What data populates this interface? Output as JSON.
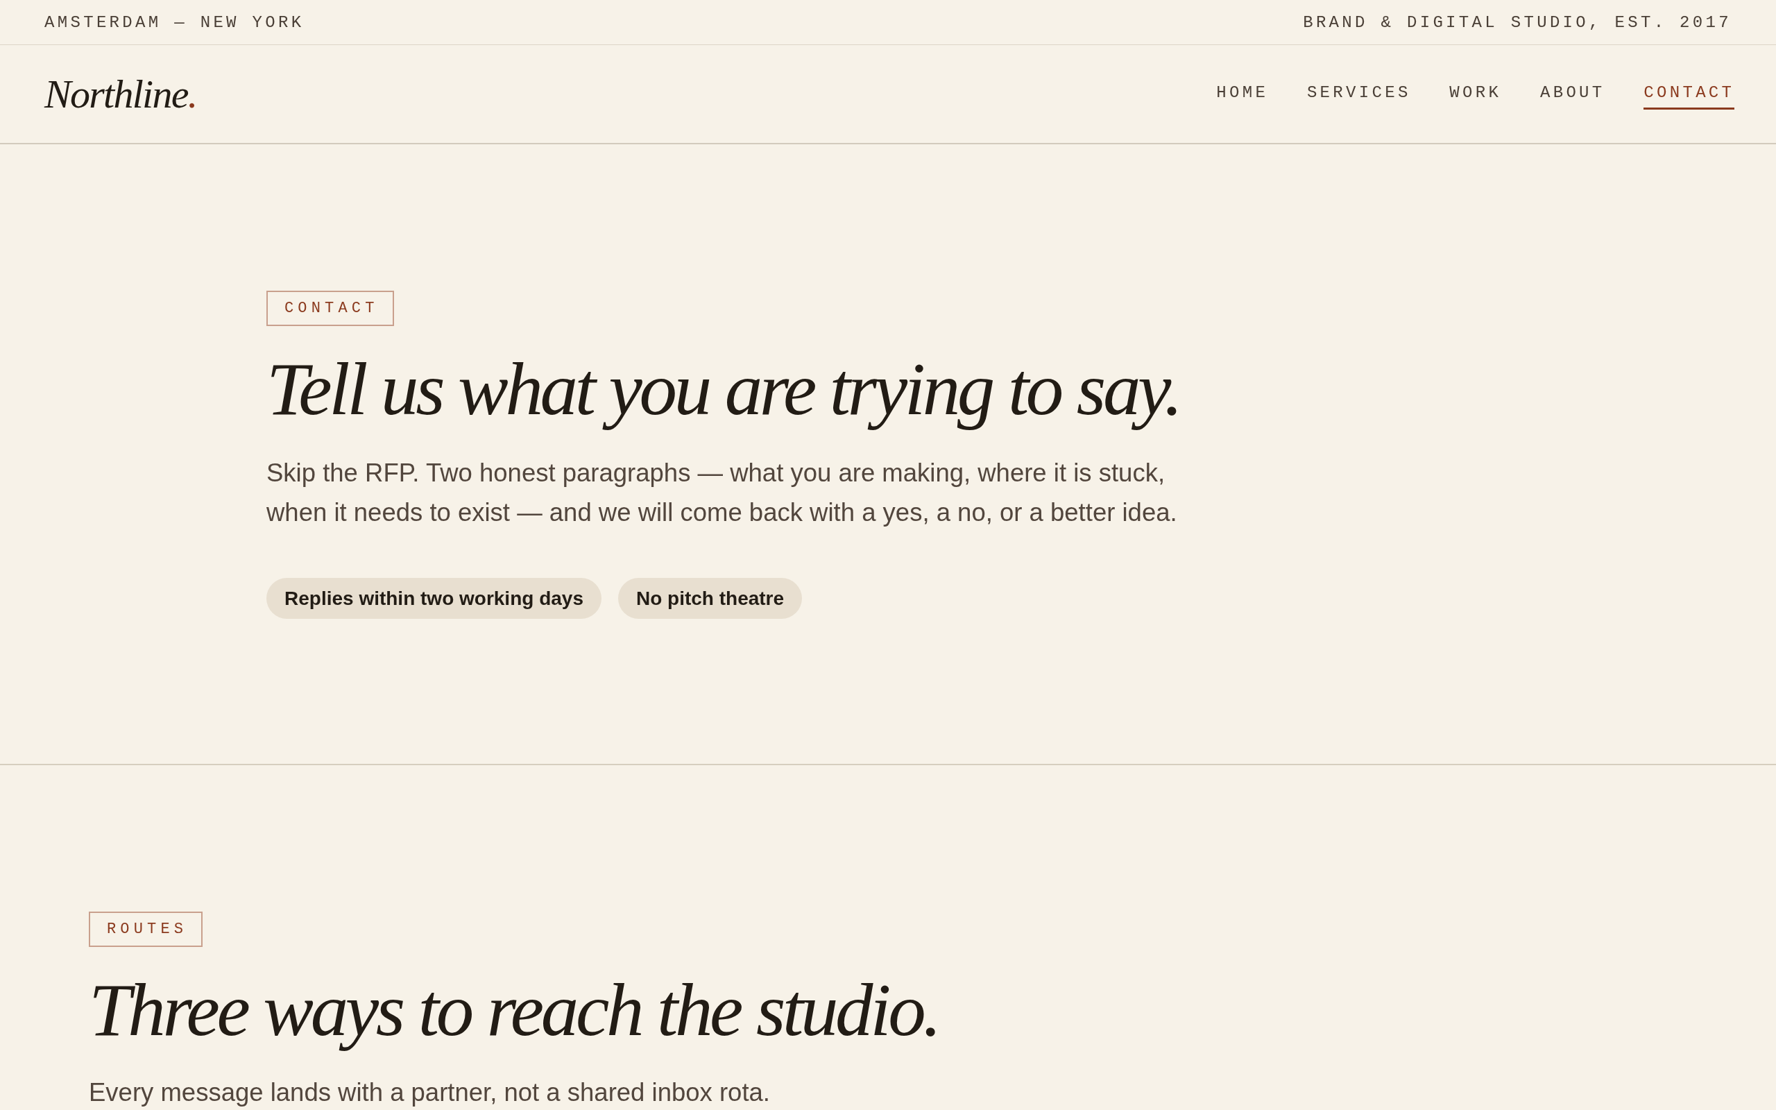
{
  "top_bar": {
    "location": "AMSTERDAM — NEW YORK",
    "tagline": "BRAND & DIGITAL STUDIO, EST. 2017"
  },
  "nav": {
    "logo": {
      "text": "Northline",
      "accent": "."
    },
    "links": [
      {
        "label": "HOME",
        "selected": false
      },
      {
        "label": "SERVICES",
        "selected": false
      },
      {
        "label": "WORK",
        "selected": false
      },
      {
        "label": "ABOUT",
        "selected": false
      },
      {
        "label": "CONTACT",
        "selected": true
      }
    ]
  },
  "hero": {
    "tag": "CONTACT",
    "title": "Tell us what you are trying to say.",
    "intro": "Skip the RFP. Two honest paragraphs — what you are making, where it is stuck, when it needs to exist — and we will come back with a yes, a no, or a better idea.",
    "chips": [
      "Replies within two working days",
      "No pitch theatre"
    ]
  },
  "routes": {
    "tag": "ROUTES",
    "title": "Three ways to reach the studio.",
    "intro": "Every message lands with a partner, not a shared inbox rota."
  }
}
